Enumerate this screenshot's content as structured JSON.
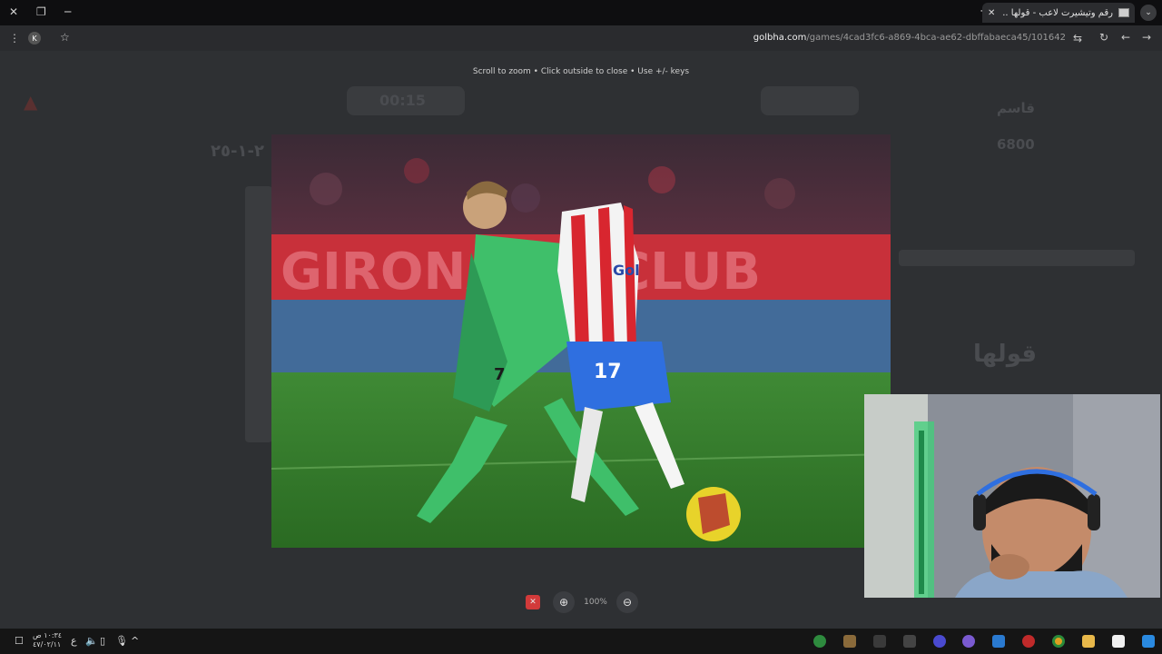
{
  "browser": {
    "tab_title": "رقم وتيشيرت لاعب - قولها .. عدا",
    "url_domain": "golbha.com",
    "url_path": "/games/4cad3fc6-a869-4bca-ae62-dbffabaeca45/101642"
  },
  "background_page": {
    "timer": "00:15",
    "score": "٢-١-٢٥",
    "label_top": "قاسم",
    "points": "6800",
    "logo_text": "قولها"
  },
  "viewer": {
    "hint": "Scroll to zoom • Click outside to close • Use +/- keys",
    "zoom_level": "100%",
    "image": {
      "player_left_number": "7",
      "player_right_number": "17",
      "sponsor": "Gol",
      "board_text": "GIRONA FC CLUB"
    }
  },
  "taskbar": {
    "time": "١٠:٣٤ ص",
    "date": "٤٧/٠٢/١١",
    "lang": "ع"
  },
  "colors": {
    "accent_red": "#d23a3a",
    "green_kit": "#3fbf6a",
    "girona_red": "#d8262f"
  }
}
